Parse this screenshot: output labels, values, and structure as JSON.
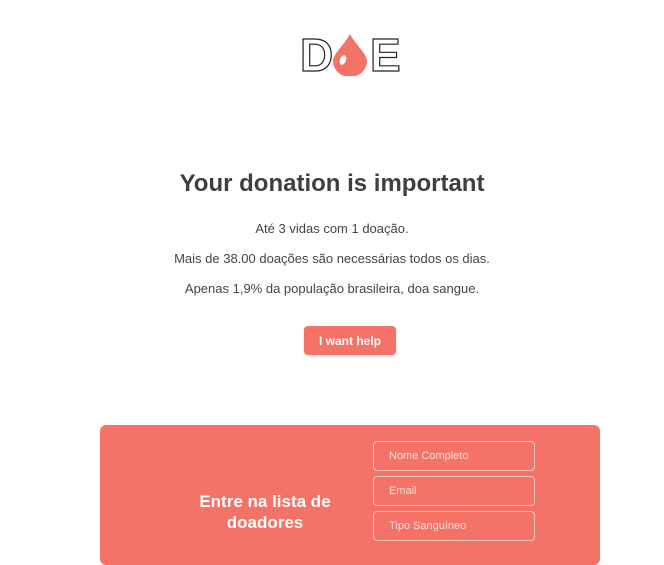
{
  "brand": {
    "logo_text_left": "D",
    "logo_text_right": "E",
    "accent_color": "#f47266"
  },
  "hero": {
    "headline": "Your donation is important",
    "facts": [
      "Até 3 vidas com 1 doação.",
      "Mais de 38.00 doações são necessárias todos os dias.",
      "Apenas 1,9% da população brasileira, doa sangue."
    ],
    "cta_label": "I want help"
  },
  "signup": {
    "title": "Entre na lista de doadores",
    "fields": {
      "name_placeholder": "Nome Completo",
      "email_placeholder": "Email",
      "blood_type_placeholder": "Tipo Sanguíneo"
    }
  },
  "icons": {
    "logo_drop": "blood-drop-icon"
  }
}
